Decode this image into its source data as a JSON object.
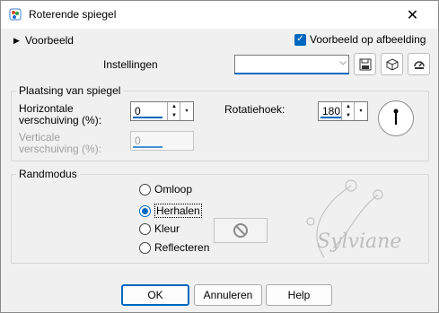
{
  "window": {
    "title": "Roterende spiegel",
    "close_glyph": "✕"
  },
  "top": {
    "preview_toggle_label": "Voorbeeld",
    "preview_checkbox_label": "Voorbeeld op afbeelding",
    "preview_checkbox_checked": true,
    "settings_label": "Instellingen",
    "settings_value": ""
  },
  "mirror_group": {
    "title": "Plaatsing van spiegel",
    "horizontal_label_line1": "Horizontale",
    "horizontal_label_line2": "verschuiving (%):",
    "horizontal_value": "0",
    "vertical_label_line1": "Verticale",
    "vertical_label_line2": "verschuiving (%):",
    "vertical_value": "0",
    "rotation_label": "Rotatiehoek:",
    "rotation_value": "180"
  },
  "edge_group": {
    "title": "Randmodus",
    "options": [
      {
        "label": "Omloop",
        "selected": false
      },
      {
        "label": "Herhalen",
        "selected": true
      },
      {
        "label": "Kleur",
        "selected": false
      },
      {
        "label": "Reflecteren",
        "selected": false
      }
    ]
  },
  "buttons": {
    "ok": "OK",
    "cancel": "Annuleren",
    "help": "Help"
  },
  "watermark_text": "Sylviane",
  "colors": {
    "accent": "#0067c0",
    "background": "#f0f0f0"
  },
  "icons": {
    "app": "paint-icon",
    "save": "save-icon",
    "reset": "cube-icon",
    "settings": "dial-icon",
    "no_color": "no-entry-icon"
  }
}
